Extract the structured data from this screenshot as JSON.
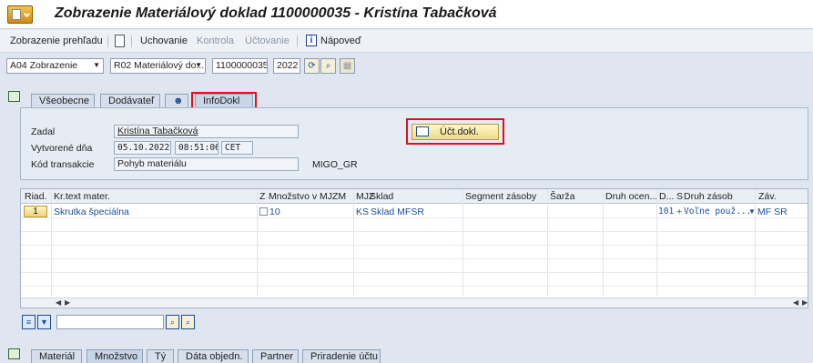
{
  "window": {
    "title": "Zobrazenie Materiálový doklad 1100000035 - Kristína Tabačková"
  },
  "toolbar": {
    "overview": "Zobrazenie prehľadu",
    "hold": "Uchovanie",
    "check": "Kontrola",
    "post": "Účtovanie",
    "help": "Nápoveď"
  },
  "selection": {
    "action": "A04 Zobrazenie",
    "doc_type": "R02 Materiálový do...",
    "doc_number": "1100000035",
    "year": "2022"
  },
  "header_tabs": [
    "Všeobecne",
    "Dodávateľ",
    "InfoDokl"
  ],
  "info": {
    "created_by_label": "Zadal",
    "created_by": "Kristína Tabačková",
    "created_on_label": "Vytvorené dňa",
    "created_date": "05.10.2022",
    "created_time": "08:51:06",
    "timezone": "CET",
    "tcode_label": "Kód transakcie",
    "tcode_desc": "Pohyb materiálu",
    "tcode": "MIGO_GR",
    "acct_doc_button": "Účt.dokl."
  },
  "table": {
    "columns": [
      "Riad.",
      "Kr.text mater.",
      "Z",
      "Množstvo v MJZM",
      "MJZ",
      "Sklad",
      "Segment zásoby",
      "Šarža",
      "Druh ocen...",
      "D...",
      "S",
      "Druh zásob",
      "Záv."
    ],
    "rows": [
      {
        "line": "1",
        "text": "Skrutka špeciálna",
        "qty": "10",
        "unit": "KS",
        "storage": "Sklad MFSR",
        "mvt": "101",
        "sign": "+",
        "stock_type": "Voľne použ...",
        "plant": "MF SR"
      }
    ]
  },
  "item_tabs": [
    "Materiál",
    "Množstvo",
    "Tý",
    "Dáta objedn.",
    "Partner",
    "Priradenie účtu"
  ]
}
